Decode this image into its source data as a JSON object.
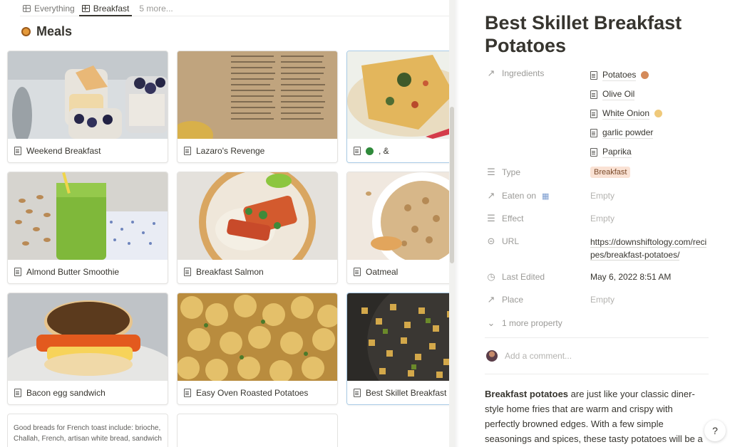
{
  "tabs": {
    "everything": "Everything",
    "breakfast": "Breakfast",
    "more": "5 more..."
  },
  "database": {
    "title": "Meals"
  },
  "cards": [
    {
      "title": "Weekend Breakfast"
    },
    {
      "title": "Lazaro's Revenge"
    },
    {
      "title": ", & "
    },
    {
      "title": "Almond Butter Smoothie"
    },
    {
      "title": "Breakfast Salmon"
    },
    {
      "title": "Oatmeal"
    },
    {
      "title": "Bacon egg sandwich"
    },
    {
      "title": "Easy Oven Roasted Potatoes"
    },
    {
      "title": "Best Skillet Breakfast"
    }
  ],
  "text_card": "Good breads for French toast include: brioche, Challah, French, artisan white bread, sandwich",
  "page": {
    "title": "Best Skillet Breakfast Potatoes",
    "properties": {
      "ingredients_label": "Ingredients",
      "ingredients": [
        "Potatoes",
        "Olive Oil",
        "White Onion",
        "garlic powder",
        "Paprika"
      ],
      "type_label": "Type",
      "type_value": "Breakfast",
      "eaten_on_label": "Eaten on",
      "eaten_on_value": "Empty",
      "effect_label": "Effect",
      "effect_value": "Empty",
      "url_label": "URL",
      "url_value": "https://downshiftology.com/recipes/breakfast-potatoes/",
      "last_edited_label": "Last Edited",
      "last_edited_value": "May 6, 2022 8:51 AM",
      "place_label": "Place",
      "place_value": "Empty",
      "more": "1 more property"
    },
    "comment_placeholder": "Add a comment...",
    "body_bold": "Breakfast potatoes",
    "body_rest": " are just like your classic diner-style home fries that are warm and crispy with perfectly browned edges. With a few simple seasonings and spices, these tasty potatoes will be a"
  },
  "help": "?",
  "colors": {
    "tag_bg": "#fae2d4",
    "selected_title_bg": "#dde9f3",
    "accent_text": "#37352f"
  }
}
